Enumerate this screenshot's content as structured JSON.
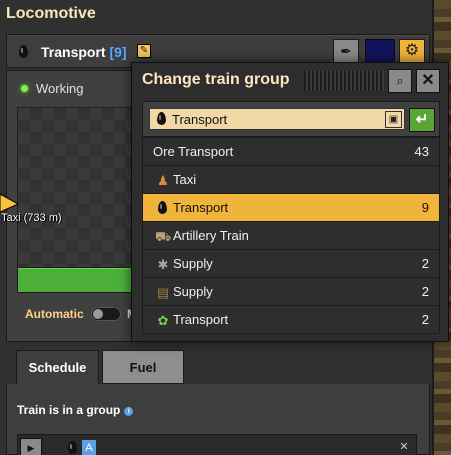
{
  "window": {
    "title": "Locomotive",
    "train_name": "Transport",
    "train_count": "[9]",
    "status": "Working",
    "map_label": "Taxi (733 m)",
    "automatic_label": "Automatic",
    "mode_letter": "M",
    "color_swatch": "#12145a"
  },
  "tabs": [
    {
      "label": "Schedule",
      "active": true
    },
    {
      "label": "Fuel",
      "active": false
    }
  ],
  "schedule": {
    "group_label": "Train is in a group",
    "row_letter": "A"
  },
  "popup": {
    "title": "Change train group",
    "input_value": "Transport",
    "groups": [
      {
        "label": "Ore Transport",
        "count": "43",
        "icon": "none",
        "selected": false
      },
      {
        "label": "Taxi",
        "count": "",
        "icon": "person-icon",
        "selected": false
      },
      {
        "label": "Transport",
        "count": "9",
        "icon": "oil-drop-icon",
        "selected": true
      },
      {
        "label": "Artillery Train",
        "count": "",
        "icon": "artillery-wagon-icon",
        "selected": false
      },
      {
        "label": "Supply",
        "count": "2",
        "icon": "spidertron-icon",
        "selected": false
      },
      {
        "label": "Supply",
        "count": "2",
        "icon": "wooden-chest-icon",
        "selected": false
      },
      {
        "label": "Transport",
        "count": "2",
        "icon": "plant-icon",
        "selected": false
      }
    ]
  },
  "colors": {
    "accent": "#f1b43a",
    "confirm": "#59a535",
    "title": "#ffe6c0"
  }
}
